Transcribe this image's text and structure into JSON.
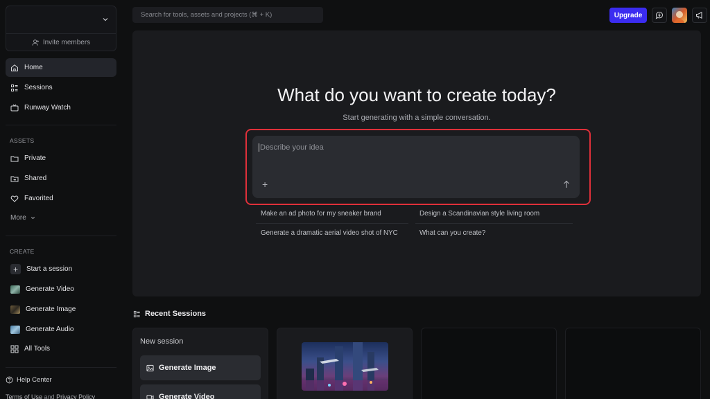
{
  "sidebar": {
    "invite_label": "Invite members",
    "nav": [
      {
        "label": "Home",
        "icon": "home-icon",
        "active": true
      },
      {
        "label": "Sessions",
        "icon": "sessions-icon"
      },
      {
        "label": "Runway Watch",
        "icon": "tv-icon"
      }
    ],
    "assets_heading": "ASSETS",
    "assets": [
      {
        "label": "Private",
        "icon": "folder-icon"
      },
      {
        "label": "Shared",
        "icon": "shared-folder-icon"
      },
      {
        "label": "Favorited",
        "icon": "heart-icon"
      }
    ],
    "more_label": "More",
    "create_heading": "CREATE",
    "create": [
      {
        "label": "Start a session",
        "icon": "plus-icon"
      },
      {
        "label": "Generate Video",
        "icon": "video-thumb-icon"
      },
      {
        "label": "Generate Image",
        "icon": "image-thumb-icon"
      },
      {
        "label": "Generate Audio",
        "icon": "audio-thumb-icon"
      },
      {
        "label": "All Tools",
        "icon": "grid-icon"
      }
    ],
    "help_label": "Help Center",
    "terms_label": "Terms of Use",
    "and_label": "and",
    "privacy_label": "Privacy Policy"
  },
  "topbar": {
    "search_placeholder": "Search for tools, assets and projects (⌘ + K)",
    "upgrade_label": "Upgrade"
  },
  "hero": {
    "title": "What do you want to create today?",
    "subtitle": "Start generating with a simple conversation.",
    "prompt_placeholder": "Describe your idea",
    "suggestions": [
      "Make an ad photo for my sneaker brand",
      "Design a Scandinavian style living room",
      "Generate a dramatic aerial video shot of NYC",
      "What can you create?"
    ]
  },
  "recent": {
    "title": "Recent Sessions",
    "new_session_label": "New session",
    "generate_image_label": "Generate Image",
    "generate_video_label": "Generate Video"
  },
  "colors": {
    "accent": "#3b2cf0",
    "highlight_outline": "#e0303a",
    "background": "#0f1011",
    "panel": "#1a1b1e"
  }
}
